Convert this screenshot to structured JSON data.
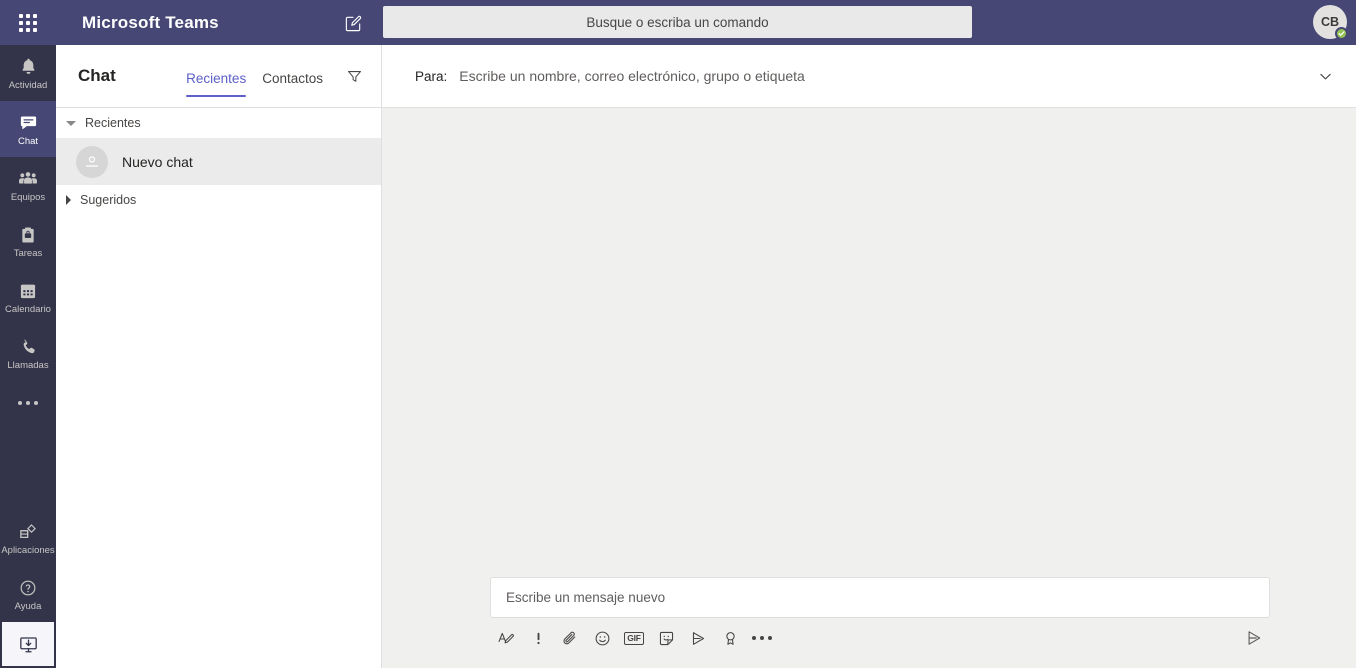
{
  "topbar": {
    "waffle_icon": "grid-apps-icon",
    "app_title": "Microsoft Teams",
    "compose_icon": "compose-pencil-icon",
    "search_placeholder": "Busque o escriba un comando",
    "avatar_initials": "CB",
    "presence_status": "available"
  },
  "rail": {
    "items": [
      {
        "label": "Actividad",
        "icon": "bell-icon",
        "active": false
      },
      {
        "label": "Chat",
        "icon": "chat-bubble-icon",
        "active": true
      },
      {
        "label": "Equipos",
        "icon": "people-icon",
        "active": false
      },
      {
        "label": "Tareas",
        "icon": "tasks-clipboard-icon",
        "active": false
      },
      {
        "label": "Calendario",
        "icon": "calendar-icon",
        "active": false
      },
      {
        "label": "Llamadas",
        "icon": "phone-icon",
        "active": false
      }
    ],
    "more_icon": "more-horizontal-icon",
    "bottom_items": [
      {
        "label": "Aplicaciones",
        "icon": "apps-icon"
      },
      {
        "label": "Ayuda",
        "icon": "help-question-icon"
      }
    ],
    "download_icon": "download-desktop-icon"
  },
  "chatlist": {
    "title": "Chat",
    "tabs": [
      {
        "label": "Recientes",
        "active": true
      },
      {
        "label": "Contactos",
        "active": false
      }
    ],
    "filter_icon": "filter-funnel-icon",
    "sections": [
      {
        "label": "Recientes",
        "expanded": true
      },
      {
        "label": "Sugeridos",
        "expanded": false
      }
    ],
    "rows": [
      {
        "name": "Nuevo chat",
        "avatar_icon": "person-avatar-icon",
        "selected": true
      }
    ]
  },
  "main": {
    "to_label": "Para:",
    "to_placeholder": "Escribe un nombre, correo electrónico, grupo o etiqueta",
    "chevron_icon": "chevron-down-icon",
    "composer": {
      "placeholder": "Escribe un mensaje nuevo",
      "toolbar": [
        {
          "icon": "format-text-icon",
          "name": "format-button"
        },
        {
          "icon": "priority-exclamation-icon",
          "name": "priority-button"
        },
        {
          "icon": "attach-paperclip-icon",
          "name": "attach-button"
        },
        {
          "icon": "emoji-smiley-icon",
          "name": "emoji-button"
        },
        {
          "icon": "gif-icon",
          "name": "gif-button",
          "text": "GIF"
        },
        {
          "icon": "sticker-icon",
          "name": "sticker-button"
        },
        {
          "icon": "stream-video-icon",
          "name": "stream-button"
        },
        {
          "icon": "praise-award-icon",
          "name": "praise-button"
        },
        {
          "icon": "more-horizontal-icon",
          "name": "more-options-button"
        }
      ],
      "send_icon": "send-paper-plane-icon"
    }
  },
  "colors": {
    "brand_purple": "#464775",
    "rail_dark": "#33344a",
    "accent": "#5b5fc7",
    "presence_green": "#92c353",
    "canvas": "#f0f0ef"
  }
}
